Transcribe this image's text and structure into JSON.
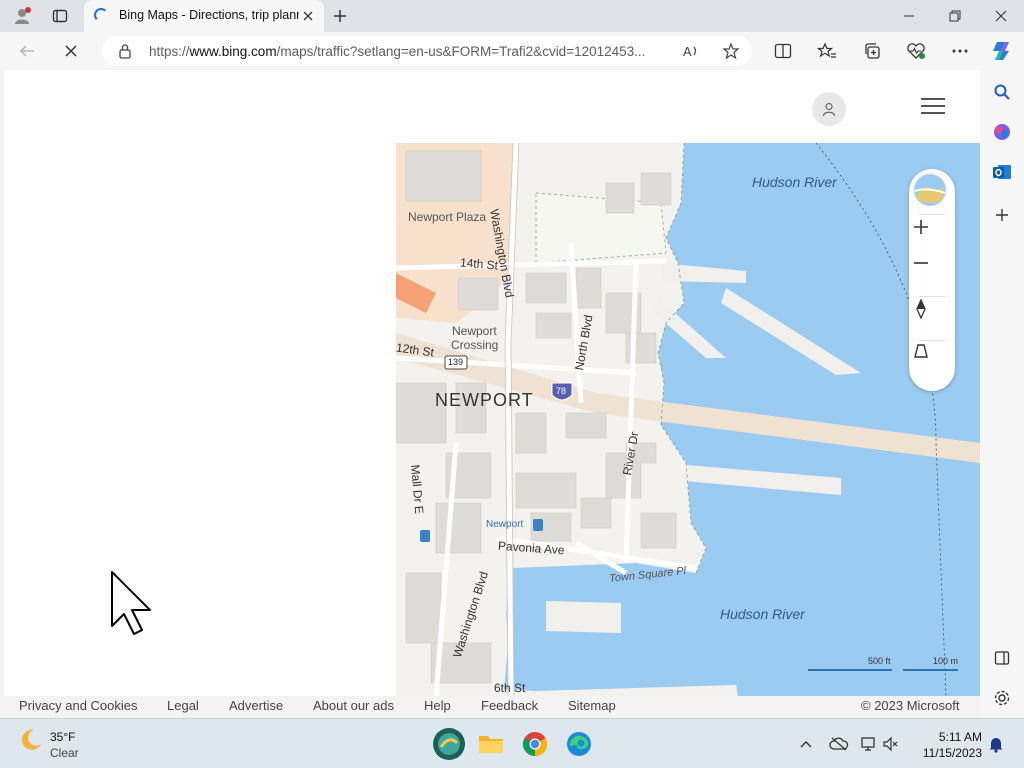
{
  "browser": {
    "tab_title": "Bing Maps - Directions, trip planner...",
    "url_prefix": "https://",
    "url_host": "www.bing.com",
    "url_path": "/maps/traffic?setlang=en-us&FORM=Trafi2&cvid=12012453...",
    "accent_color": "#1a73e8"
  },
  "page": {
    "map_labels": {
      "hudson_river_top": "Hudson River",
      "hudson_river_bottom": "Hudson River",
      "newport_plaza": "Newport Plaza",
      "washington_blvd_top": "Washington Blvd",
      "washington_blvd_bottom": "Washington Blvd",
      "fourteenth_st": "14th St",
      "twelfth_st": "12th St",
      "newport_crossing_1": "Newport",
      "newport_crossing_2": "Crossing",
      "north_blvd": "North Blvd",
      "route_139": "139",
      "interstate_78": "78",
      "newport": "NEWPORT",
      "river_dr": "River Dr",
      "mall_dr_e": "Mall Dr E",
      "newport_station": "Newport",
      "pavonia_ave": "Pavonia Ave",
      "town_square_pl": "Town Square Pl",
      "sixth_st": "6th St"
    },
    "scale": {
      "feet": "500 ft",
      "meters": "100 m"
    },
    "footer_links": [
      "Privacy and Cookies",
      "Legal",
      "Advertise",
      "About our ads",
      "Help",
      "Feedback",
      "Sitemap"
    ],
    "copyright": "© 2023 Microsoft",
    "colors": {
      "water": "#9ccbf2",
      "land": "#f4f2ee",
      "building": "#dedcd8",
      "highway": "#f5a276"
    }
  },
  "taskbar": {
    "weather_temp": "35°F",
    "weather_condition": "Clear",
    "time": "5:11 AM",
    "date": "11/15/2023"
  }
}
